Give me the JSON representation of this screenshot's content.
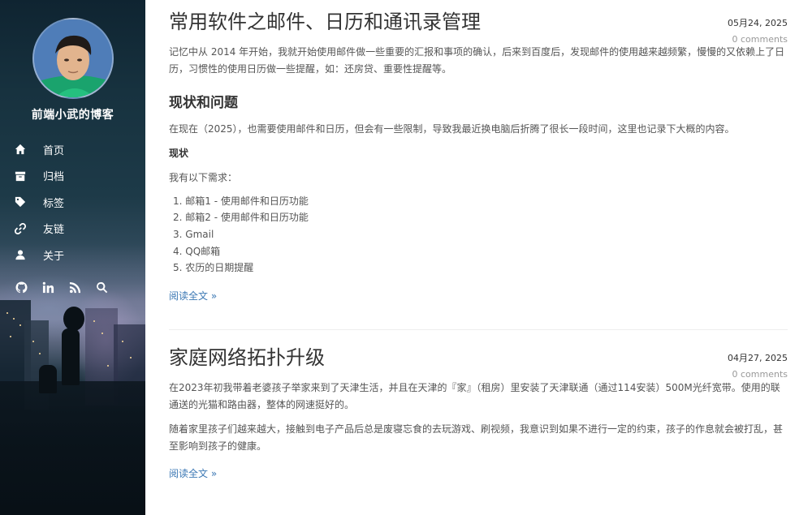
{
  "sidebar": {
    "site_title": "前端小武的博客",
    "nav": [
      {
        "label": "首页",
        "icon": "home-icon"
      },
      {
        "label": "归档",
        "icon": "archive-icon"
      },
      {
        "label": "标签",
        "icon": "tag-icon"
      },
      {
        "label": "友链",
        "icon": "link-icon"
      },
      {
        "label": "关于",
        "icon": "user-icon"
      }
    ],
    "social": [
      "github-icon",
      "linkedin-icon",
      "rss-icon",
      "search-icon"
    ]
  },
  "posts": [
    {
      "title": "常用软件之邮件、日历和通讯录管理",
      "date": "05月24, 2025",
      "comments": "0 comments",
      "intro": "记忆中从 2014 年开始，我就开始使用邮件做一些重要的汇报和事项的确认，后来到百度后，发现邮件的使用越来越频繁，慢慢的又依赖上了日历，习惯性的使用日历做一些提醒，如：还房贷、重要性提醒等。",
      "h2": "现状和问题",
      "p2": "在现在（2025），也需要使用邮件和日历，但会有一些限制，导致我最近换电脑后折腾了很长一段时间，这里也记录下大概的内容。",
      "h3": "现状",
      "p3": "我有以下需求：",
      "list": [
        "1. 邮箱1 - 使用邮件和日历功能",
        "2. 邮箱2 - 使用邮件和日历功能",
        "3. Gmail",
        "4. QQ邮箱",
        "5. 农历的日期提醒"
      ],
      "read_more": "阅读全文 »"
    },
    {
      "title": "家庭网络拓扑升级",
      "date": "04月27, 2025",
      "comments": "0 comments",
      "p1": "在2023年初我带着老婆孩子举家来到了天津生活，并且在天津的『家』（租房）里安装了天津联通（通过114安装）500M光纤宽带。使用的联通送的光猫和路由器，整体的网速挺好的。",
      "p2": "随着家里孩子们越来越大，接触到电子产品后总是废寝忘食的去玩游戏、刷视频，我意识到如果不进行一定的约束，孩子的作息就会被打乱，甚至影响到孩子的健康。",
      "read_more": "阅读全文 »"
    }
  ]
}
